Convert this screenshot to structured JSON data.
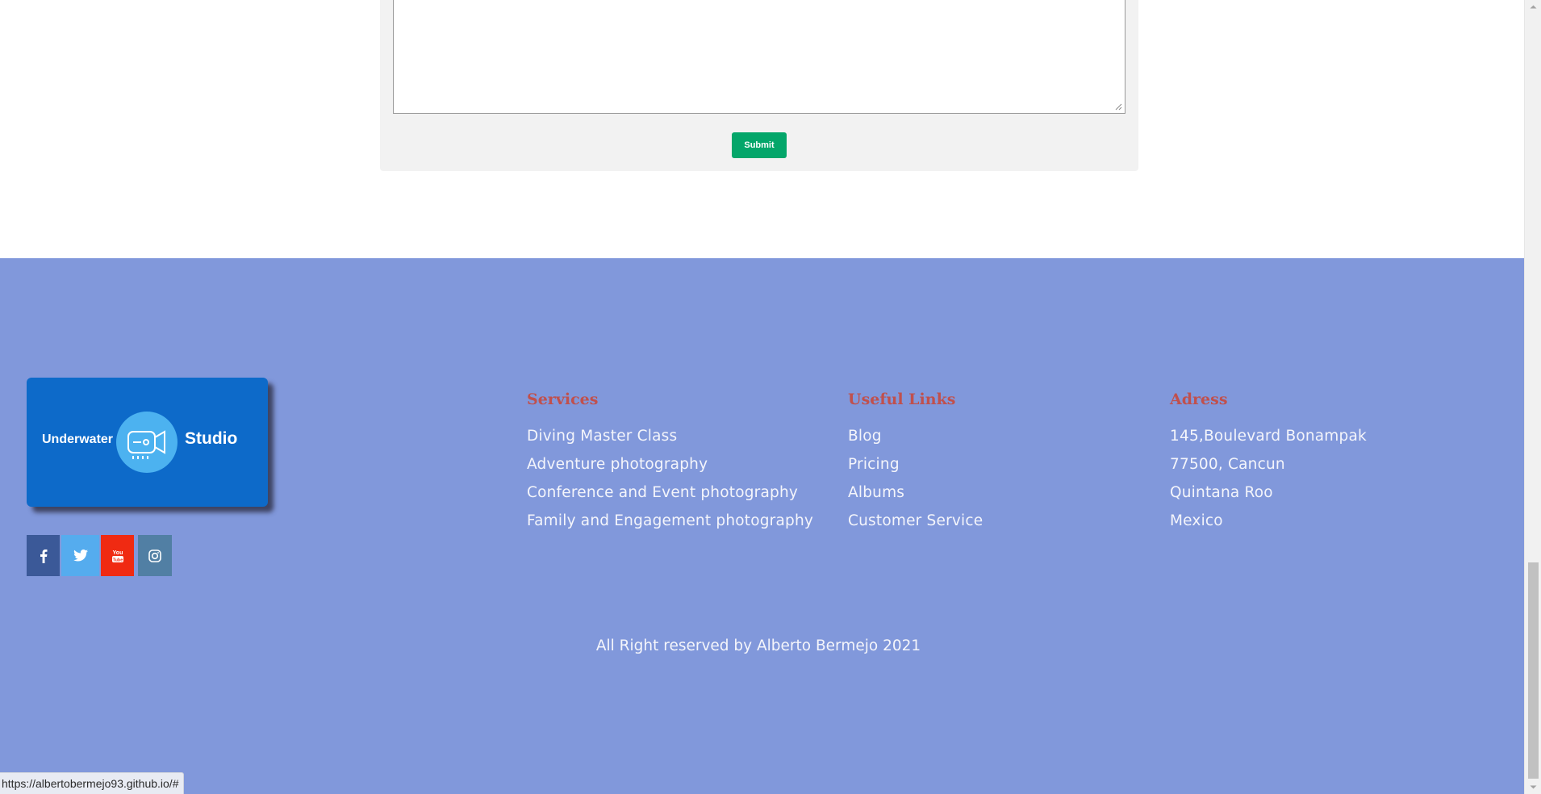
{
  "contact": {
    "message_value": "",
    "submit_label": "Submit"
  },
  "footer": {
    "logo": {
      "left_text": "Underwater",
      "right_text": "Studio",
      "icon": "video-camera-icon"
    },
    "social": [
      {
        "name": "facebook-icon",
        "glyph": "f",
        "color": "#3b5998"
      },
      {
        "name": "twitter-icon",
        "color": "#55acee"
      },
      {
        "name": "youtube-icon",
        "glyph": "You",
        "color": "#f02a12"
      },
      {
        "name": "instagram-icon",
        "color": "#517fa4"
      }
    ],
    "services": {
      "title": "Services",
      "items": [
        "Diving Master Class",
        "Adventure photography",
        "Conference and Event photography",
        "Family and Engagement photography"
      ]
    },
    "useful_links": {
      "title": "Useful Links",
      "items": [
        "Blog",
        "Pricing",
        "Albums",
        "Customer Service"
      ]
    },
    "address": {
      "title": "Adress",
      "lines": [
        "145,Boulevard Bonampak",
        "77500, Cancun",
        "Quintana Roo",
        "Mexico"
      ]
    },
    "copyright": "All Right reserved by Alberto Bermejo 2021"
  },
  "status_bar": {
    "url": "https://albertobermejo93.github.io/#"
  },
  "colors": {
    "footer_bg": "#8198db",
    "heading": "#c0504d",
    "submit": "#04a66a",
    "logo_bg": "#0d6ac9"
  }
}
